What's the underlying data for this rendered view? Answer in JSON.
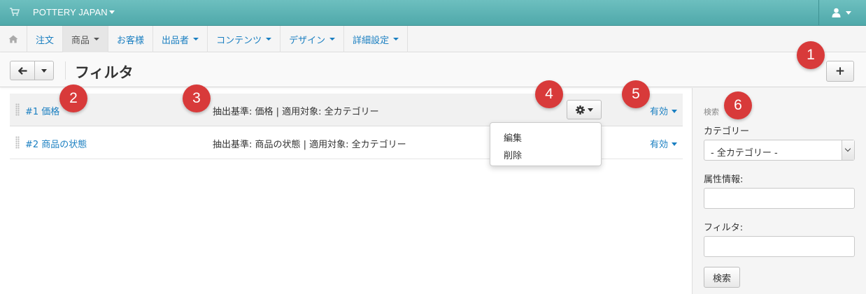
{
  "header": {
    "brand": "POTTERY JAPAN",
    "icons": [
      "cart-icon",
      "user-icon"
    ]
  },
  "nav": {
    "items": [
      {
        "label": "注文",
        "has_caret": false
      },
      {
        "label": "商品",
        "has_caret": true,
        "active": true
      },
      {
        "label": "お客様",
        "has_caret": false
      },
      {
        "label": "出品者",
        "has_caret": true
      },
      {
        "label": "コンテンツ",
        "has_caret": true
      },
      {
        "label": "デザイン",
        "has_caret": true
      },
      {
        "label": "詳細設定",
        "has_caret": true
      }
    ]
  },
  "toolbar": {
    "title": "フィルタ",
    "add_label": "+"
  },
  "filters": [
    {
      "name": "#1 価格",
      "description": "抽出基準: 価格 | 適用対象: 全カテゴリー",
      "status": "有効"
    },
    {
      "name": "#2 商品の状態",
      "description": "抽出基準: 商品の状態 | 適用対象: 全カテゴリー",
      "status": "有効"
    }
  ],
  "dropdown": {
    "items": [
      "編集",
      "削除"
    ]
  },
  "sidebar": {
    "heading": "検索",
    "category_label": "カテゴリー",
    "category_value": "- 全カテゴリー -",
    "feature_label": "属性情報:",
    "feature_value": "",
    "filter_label": "フィルタ:",
    "filter_value": "",
    "search_button": "検索"
  },
  "callouts": [
    "1",
    "2",
    "3",
    "4",
    "5",
    "6"
  ],
  "colors": {
    "header": "#5bb3b4",
    "link": "#1a7fc1",
    "callout": "#d83a3a"
  }
}
